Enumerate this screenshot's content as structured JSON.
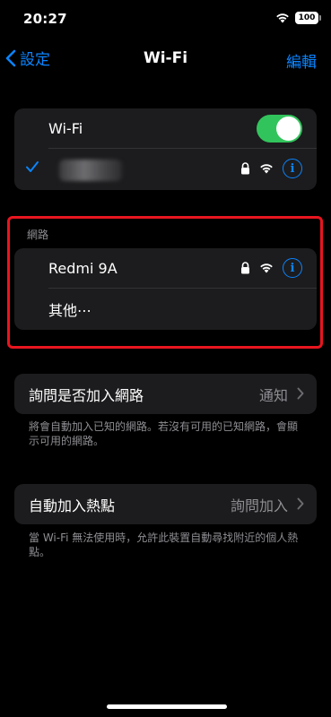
{
  "status_bar": {
    "time": "20:27",
    "battery": "100"
  },
  "nav": {
    "back_label": "設定",
    "title": "Wi-Fi",
    "edit_label": "編輯"
  },
  "wifi_group": {
    "wifi_label": "Wi-Fi",
    "wifi_enabled": true
  },
  "networks": {
    "header": "網路",
    "items": [
      {
        "name": "Redmi 9A",
        "secured": true
      },
      {
        "name": "其他⋯"
      }
    ]
  },
  "ask_join": {
    "label": "詢問是否加入網路",
    "value": "通知",
    "footer": "將會自動加入已知的網路。若沒有可用的已知網路，會顯示可用的網路。"
  },
  "auto_join_hotspot": {
    "label": "自動加入熱點",
    "value": "詢問加入",
    "footer": "當 Wi-Fi 無法使用時，允許此裝置自動尋找附近的個人熱點。"
  },
  "colors": {
    "accent": "#0a84ff",
    "toggle_on": "#32c45c",
    "highlight": "#e8151f"
  }
}
